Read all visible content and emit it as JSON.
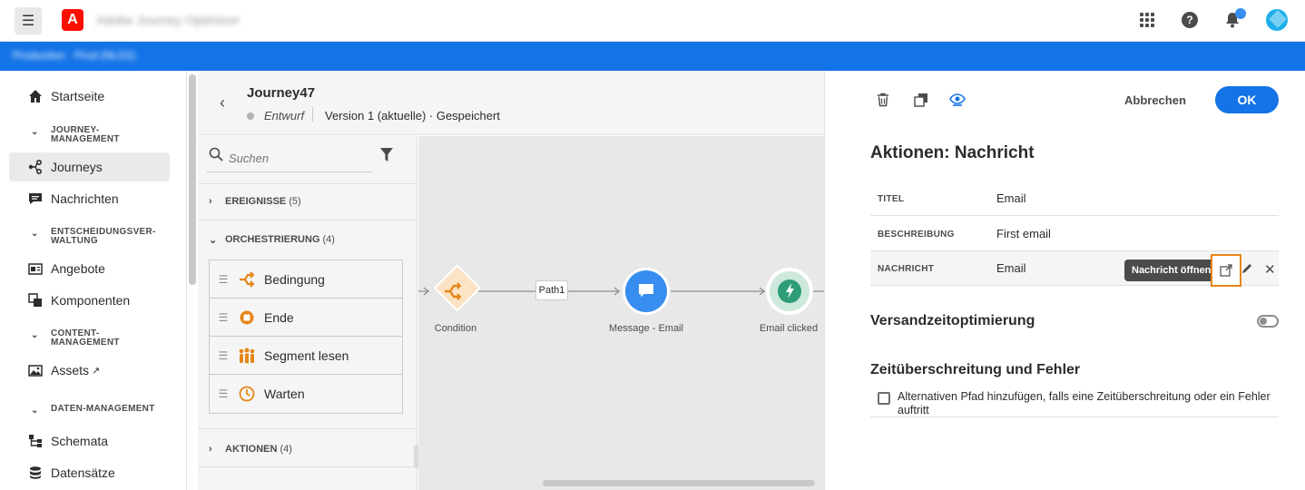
{
  "topbar": {
    "org_name": "Adobe Journey Optimizer",
    "adobe_logo": "A",
    "help_label": "?"
  },
  "bluebar": {
    "sandbox": "Production · Prod (NLD2)"
  },
  "nav": {
    "home": "Startseite",
    "section_journey": "JOURNEY-\nMANAGEMENT",
    "journeys": "Journeys",
    "messages": "Nachrichten",
    "section_decision": "ENTSCHEIDUNGSVER-\nWALTUNG",
    "offers": "Angebote",
    "components": "Komponenten",
    "section_content": "CONTENT-\nMANAGEMENT",
    "assets": "Assets",
    "section_data": "DATEN-MANAGEMENT",
    "schemas": "Schemata",
    "datasets": "Datensätze"
  },
  "journey": {
    "title": "Journey47",
    "status": "Entwurf",
    "version": "Version 1 (aktuelle) · Gespeichert"
  },
  "palette": {
    "search_placeholder": "Suchen",
    "sections": {
      "events": {
        "label": "EREIGNISSE",
        "count": "(5)"
      },
      "orchestration": {
        "label": "ORCHESTRIERUNG",
        "count": "(4)"
      },
      "actions": {
        "label": "AKTIONEN",
        "count": "(4)"
      }
    },
    "items": [
      {
        "label": "Bedingung",
        "icon": "condition-icon"
      },
      {
        "label": "Ende",
        "icon": "end-icon"
      },
      {
        "label": "Segment lesen",
        "icon": "segment-icon"
      },
      {
        "label": "Warten",
        "icon": "wait-icon"
      }
    ]
  },
  "canvas": {
    "path_label": "Path1",
    "nodes": [
      {
        "label": "Condition",
        "icon": "condition-icon"
      },
      {
        "label": "Message - Email",
        "icon": "message-icon"
      },
      {
        "label": "Email clicked",
        "icon": "bolt-icon"
      }
    ],
    "colors": {
      "condition": "#e68619",
      "message": "#378ef0",
      "event": "#2d9d78"
    }
  },
  "panel": {
    "cancel": "Abbrechen",
    "ok": "OK",
    "title": "Aktionen: Nachricht",
    "props": [
      {
        "key": "TITEL",
        "value": "Email"
      },
      {
        "key": "BESCHREIBUNG",
        "value": "First email"
      },
      {
        "key": "NACHRICHT",
        "value": "Email"
      }
    ],
    "tooltip": "Nachricht öffnen",
    "send_time": "Versandzeitoptimierung",
    "timeout_title": "Zeitüberschreitung und Fehler",
    "timeout_checkbox": "Alternativen Pfad hinzufügen, falls eine Zeitüberschreitung oder ein Fehler auftritt"
  }
}
